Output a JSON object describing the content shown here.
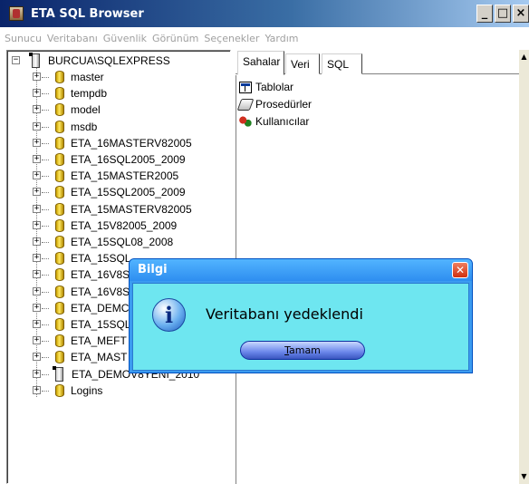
{
  "window": {
    "title": "ETA SQL Browser",
    "controls": {
      "minimize": "_",
      "maximize": "□",
      "close": "×"
    }
  },
  "menu": {
    "items": [
      "Sunucu",
      "Veritabanı",
      "Güvenlik",
      "Görünüm",
      "Seçenekler",
      "Yardım"
    ]
  },
  "tree": {
    "root_label": "BURCUA\\SQLEXPRESS",
    "items": [
      "master",
      "tempdb",
      "model",
      "msdb",
      "ETA_16MASTERV82005",
      "ETA_16SQL2005_2009",
      "ETA_15MASTER2005",
      "ETA_15SQL2005_2009",
      "ETA_15MASTERV82005",
      "ETA_15V82005_2009",
      "ETA_15SQL08_2008",
      "ETA_15SQL",
      "ETA_16V8S",
      "ETA_16V8S",
      "ETA_DEMC",
      "ETA_15SQL",
      "ETA_MEFT",
      "ETA_MAST",
      "ETA_DEMOV8YENI_2010",
      "Logins"
    ]
  },
  "tabs": [
    "Sahalar",
    "Veri",
    "SQL"
  ],
  "pane": {
    "items": [
      "Tablolar",
      "Prosedürler",
      "Kullanıcılar"
    ]
  },
  "dialog": {
    "title": "Bilgi",
    "message": "Veritabanı yedeklendi",
    "ok_label_underlined": "T",
    "ok_label_rest": "amam"
  },
  "colors": {
    "title_bar_start": "#0a246a",
    "dialog_body": "#6ee6f0",
    "menu_disabled_text": "#a0a0a0"
  }
}
